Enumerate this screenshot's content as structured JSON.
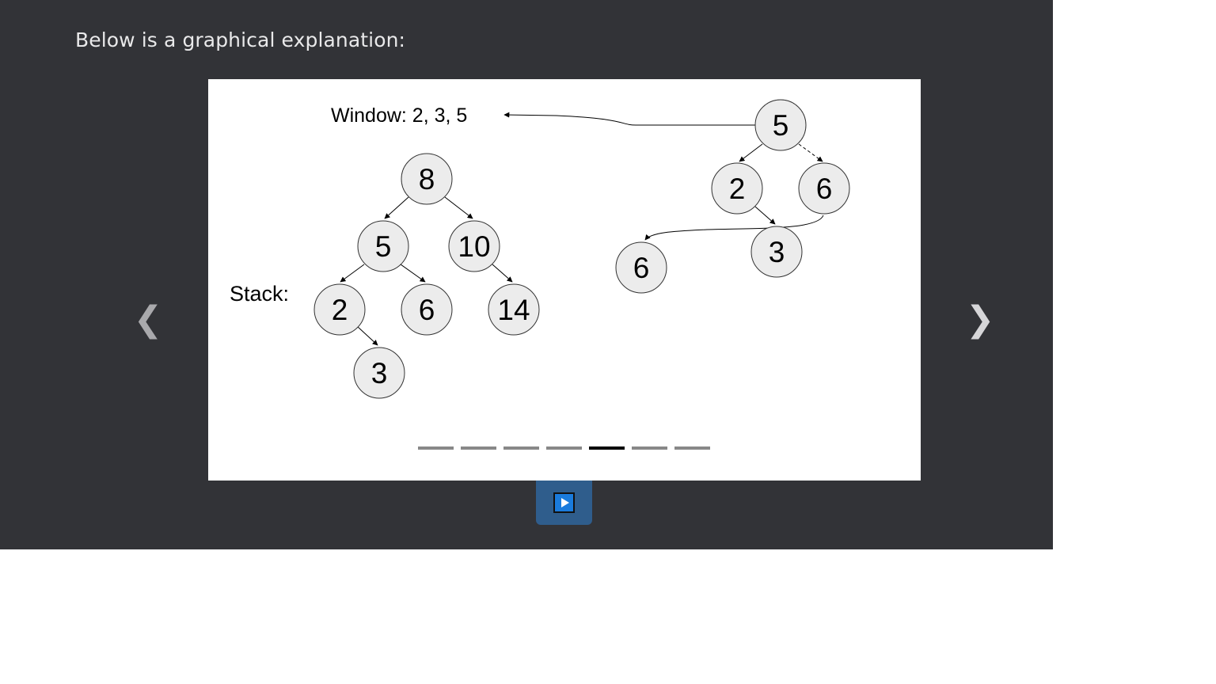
{
  "heading": "Below is a graphical explanation:",
  "slideshow": {
    "prev_glyph": "❮",
    "next_glyph": "❯",
    "play_icon": "play-icon",
    "slide_count": 7,
    "active_slide": 5
  },
  "diagram": {
    "window_label": "Window: 2, 3, 5",
    "stack_label": "Stack:",
    "stack_tree": {
      "root": "8",
      "level2": [
        "5",
        "10"
      ],
      "level3": [
        "2",
        "6",
        "14"
      ],
      "level4": [
        "3"
      ]
    },
    "window_tree": {
      "root": "5",
      "level2": [
        "2",
        "6"
      ],
      "right_child_of_2": "3",
      "detached": "6"
    }
  },
  "colors": {
    "panel_bg": "#323337",
    "node_fill": "#ececec",
    "active_dot": "#000000",
    "inactive_dot": "#888888",
    "play_button": "#2f5d8c"
  }
}
